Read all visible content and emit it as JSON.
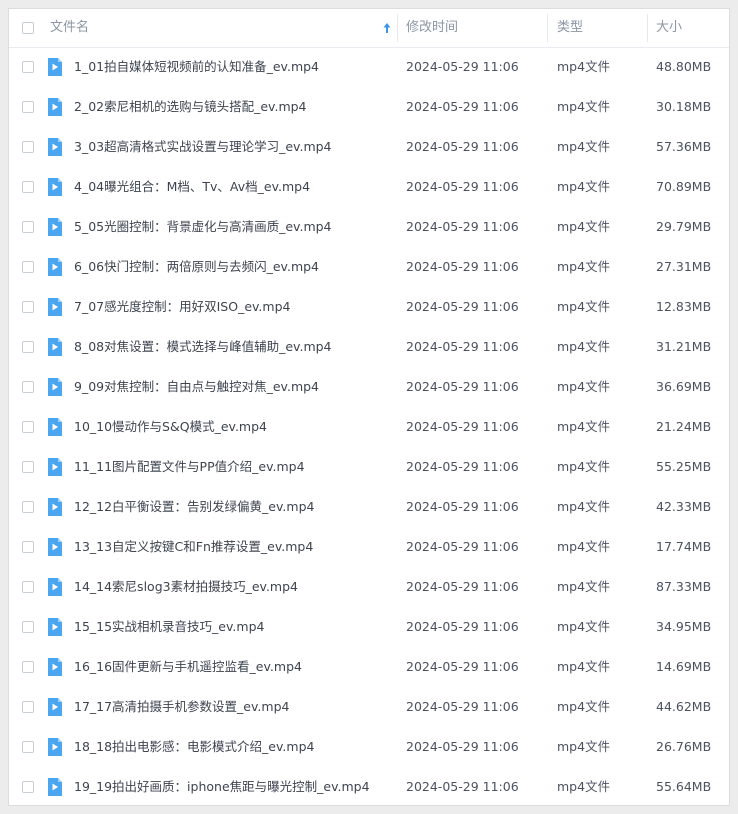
{
  "header": {
    "name": "文件名",
    "modified": "修改时间",
    "type": "类型",
    "size": "大小"
  },
  "colors": {
    "icon_blue": "#4aa6f0",
    "sort_arrow": "#3a95e8"
  },
  "files": [
    {
      "name": "1_01拍自媒体短视频前的认知准备_ev.mp4",
      "time": "2024-05-29 11:06",
      "type": "mp4文件",
      "size": "48.80MB"
    },
    {
      "name": "2_02索尼相机的选购与镜头搭配_ev.mp4",
      "time": "2024-05-29 11:06",
      "type": "mp4文件",
      "size": "30.18MB"
    },
    {
      "name": "3_03超高清格式实战设置与理论学习_ev.mp4",
      "time": "2024-05-29 11:06",
      "type": "mp4文件",
      "size": "57.36MB"
    },
    {
      "name": "4_04曝光组合：M档、Tv、Av档_ev.mp4",
      "time": "2024-05-29 11:06",
      "type": "mp4文件",
      "size": "70.89MB"
    },
    {
      "name": "5_05光圈控制：背景虚化与高清画质_ev.mp4",
      "time": "2024-05-29 11:06",
      "type": "mp4文件",
      "size": "29.79MB"
    },
    {
      "name": "6_06快门控制：两倍原则与去频闪_ev.mp4",
      "time": "2024-05-29 11:06",
      "type": "mp4文件",
      "size": "27.31MB"
    },
    {
      "name": "7_07感光度控制：用好双ISO_ev.mp4",
      "time": "2024-05-29 11:06",
      "type": "mp4文件",
      "size": "12.83MB"
    },
    {
      "name": "8_08对焦设置：模式选择与峰值辅助_ev.mp4",
      "time": "2024-05-29 11:06",
      "type": "mp4文件",
      "size": "31.21MB"
    },
    {
      "name": "9_09对焦控制：自由点与触控对焦_ev.mp4",
      "time": "2024-05-29 11:06",
      "type": "mp4文件",
      "size": "36.69MB"
    },
    {
      "name": "10_10慢动作与S&Q模式_ev.mp4",
      "time": "2024-05-29 11:06",
      "type": "mp4文件",
      "size": "21.24MB"
    },
    {
      "name": "11_11图片配置文件与PP值介绍_ev.mp4",
      "time": "2024-05-29 11:06",
      "type": "mp4文件",
      "size": "55.25MB"
    },
    {
      "name": "12_12白平衡设置：告别发绿偏黄_ev.mp4",
      "time": "2024-05-29 11:06",
      "type": "mp4文件",
      "size": "42.33MB"
    },
    {
      "name": "13_13自定义按键C和Fn推荐设置_ev.mp4",
      "time": "2024-05-29 11:06",
      "type": "mp4文件",
      "size": "17.74MB"
    },
    {
      "name": "14_14索尼slog3素材拍摄技巧_ev.mp4",
      "time": "2024-05-29 11:06",
      "type": "mp4文件",
      "size": "87.33MB"
    },
    {
      "name": "15_15实战相机录音技巧_ev.mp4",
      "time": "2024-05-29 11:06",
      "type": "mp4文件",
      "size": "34.95MB"
    },
    {
      "name": "16_16固件更新与手机遥控监看_ev.mp4",
      "time": "2024-05-29 11:06",
      "type": "mp4文件",
      "size": "14.69MB"
    },
    {
      "name": "17_17高清拍摄手机参数设置_ev.mp4",
      "time": "2024-05-29 11:06",
      "type": "mp4文件",
      "size": "44.62MB"
    },
    {
      "name": "18_18拍出电影感：电影模式介绍_ev.mp4",
      "time": "2024-05-29 11:06",
      "type": "mp4文件",
      "size": "26.76MB"
    },
    {
      "name": "19_19拍出好画质：iphone焦距与曝光控制_ev.mp4",
      "time": "2024-05-29 11:06",
      "type": "mp4文件",
      "size": "55.64MB"
    }
  ]
}
